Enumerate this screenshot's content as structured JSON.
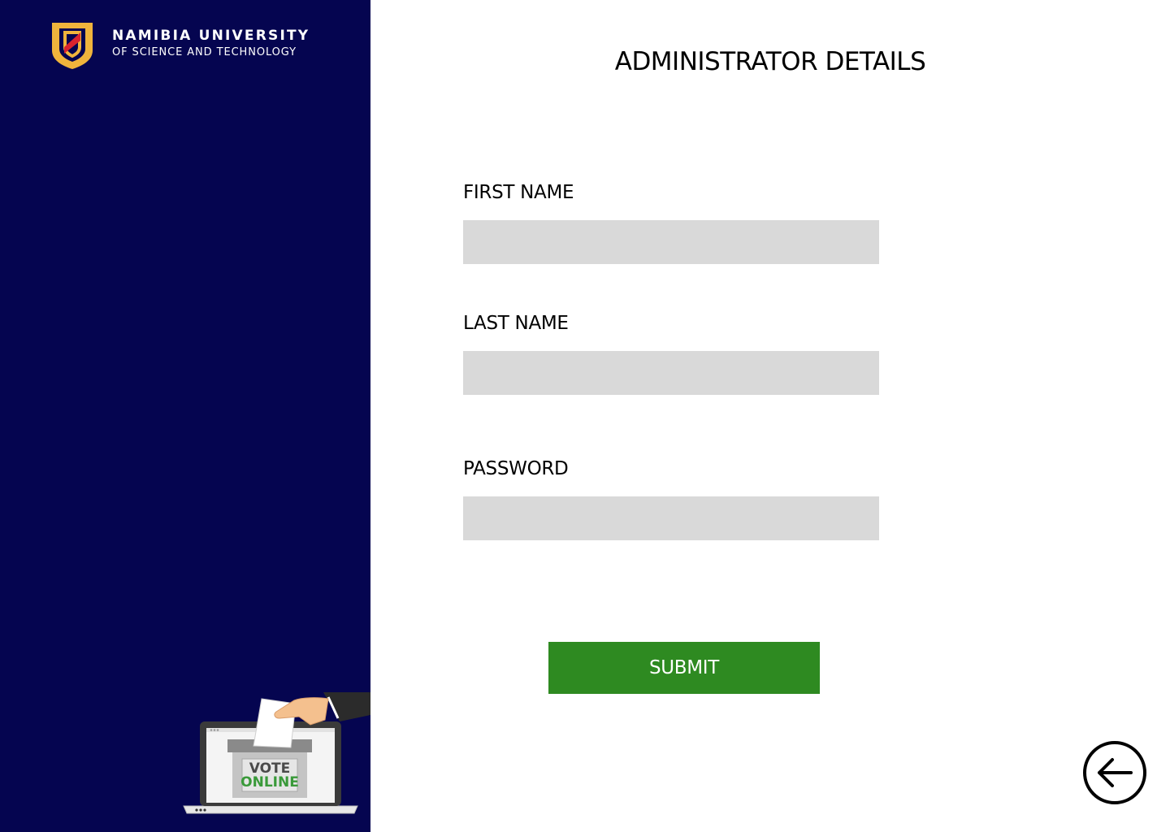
{
  "sidebar": {
    "logo": {
      "line1": "Namibia University",
      "line2": "of Science and Technology"
    },
    "illustration": {
      "line1": "VOTE",
      "line2": "ONLINE"
    }
  },
  "main": {
    "title": "ADMINISTRATOR DETAILS",
    "fields": [
      {
        "label": "FIRST NAME",
        "value": "",
        "placeholder": ""
      },
      {
        "label": "LAST NAME",
        "value": "",
        "placeholder": ""
      },
      {
        "label": "PASSWORD",
        "value": "",
        "placeholder": ""
      }
    ],
    "submit_label": "SUBMIT"
  },
  "colors": {
    "sidebar_bg": "#050550",
    "input_bg": "#d9d9d9",
    "submit_bg": "#2e8a21",
    "logo_accent": "#f0b43c",
    "logo_red": "#d9232e",
    "vote_green": "#3a9a3a"
  },
  "icons": {
    "logo": "university-shield-icon",
    "back": "arrow-left-circle-icon"
  }
}
